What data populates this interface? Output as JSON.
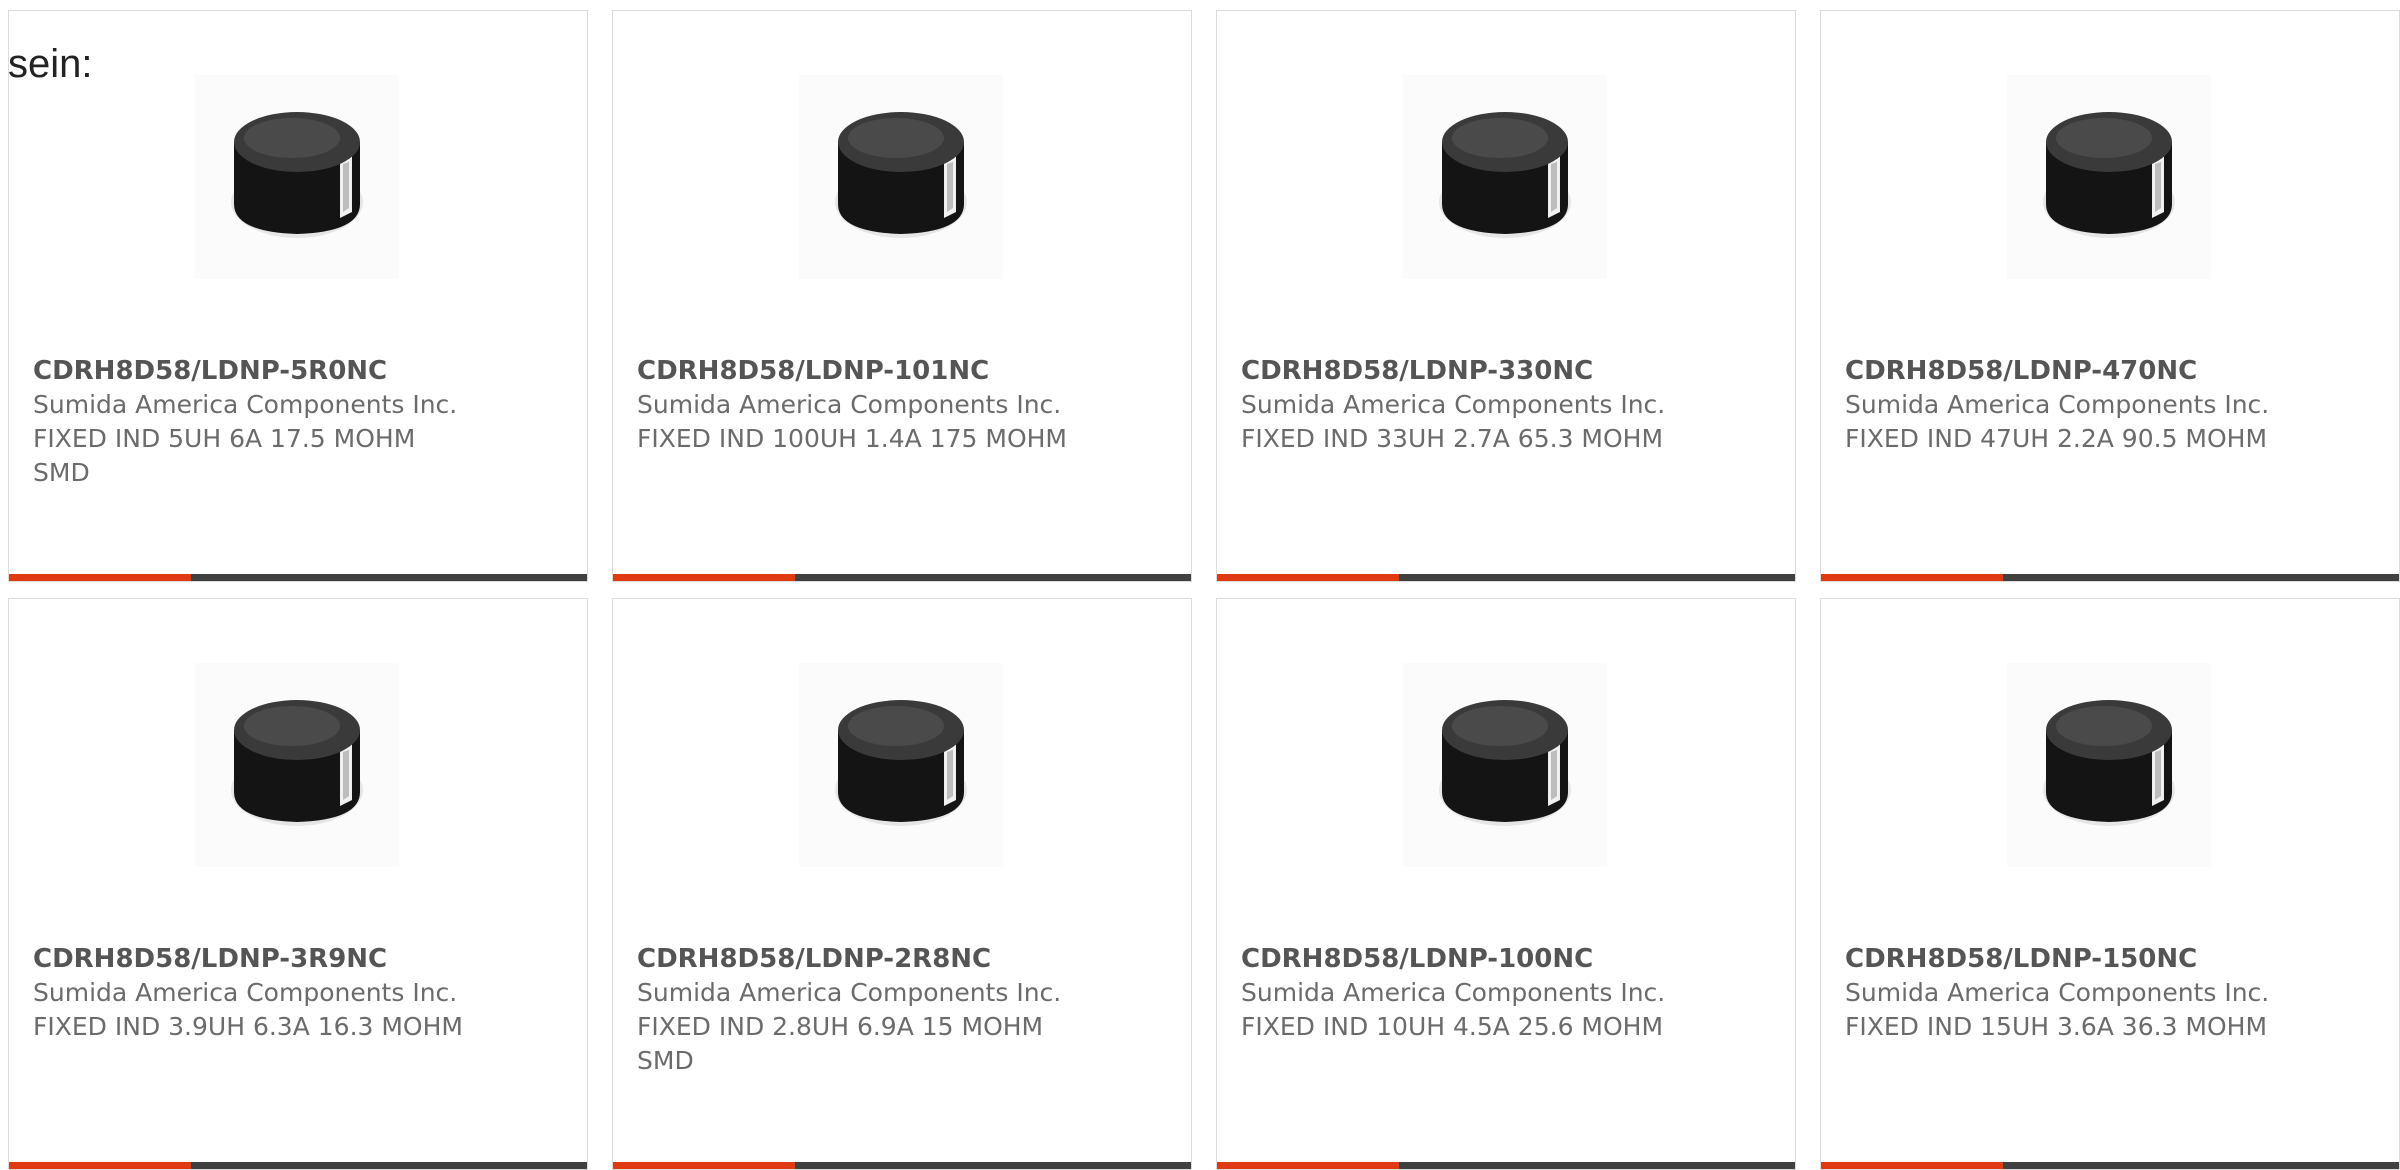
{
  "intro_text": "sein:",
  "colors": {
    "accent": "#e03a12",
    "bar_dark": "#404040"
  },
  "product_image_icon": "inductor-icon",
  "products": [
    {
      "part_number": "CDRH8D58/LDNP-5R0NC",
      "manufacturer": "Sumida America Components Inc.",
      "description": "FIXED IND 5UH 6A 17.5 MOHM SMD"
    },
    {
      "part_number": "CDRH8D58/LDNP-101NC",
      "manufacturer": "Sumida America Components Inc.",
      "description": "FIXED IND 100UH 1.4A 175 MOHM"
    },
    {
      "part_number": "CDRH8D58/LDNP-330NC",
      "manufacturer": "Sumida America Components Inc.",
      "description": "FIXED IND 33UH 2.7A 65.3 MOHM"
    },
    {
      "part_number": "CDRH8D58/LDNP-470NC",
      "manufacturer": "Sumida America Components Inc.",
      "description": "FIXED IND 47UH 2.2A 90.5 MOHM"
    },
    {
      "part_number": "CDRH8D58/LDNP-3R9NC",
      "manufacturer": "Sumida America Components Inc.",
      "description": "FIXED IND 3.9UH 6.3A 16.3 MOHM"
    },
    {
      "part_number": "CDRH8D58/LDNP-2R8NC",
      "manufacturer": "Sumida America Components Inc.",
      "description": "FIXED IND 2.8UH 6.9A 15 MOHM SMD"
    },
    {
      "part_number": "CDRH8D58/LDNP-100NC",
      "manufacturer": "Sumida America Components Inc.",
      "description": "FIXED IND 10UH 4.5A 25.6 MOHM"
    },
    {
      "part_number": "CDRH8D58/LDNP-150NC",
      "manufacturer": "Sumida America Components Inc.",
      "description": "FIXED IND 15UH 3.6A 36.3 MOHM"
    }
  ]
}
